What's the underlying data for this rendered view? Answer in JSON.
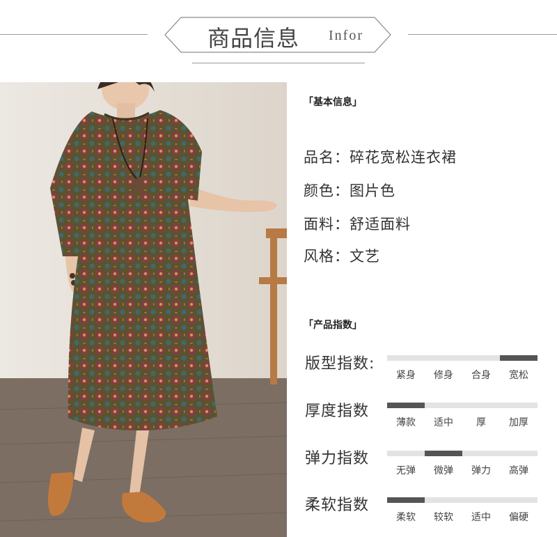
{
  "header": {
    "title_cn": "商品信息",
    "title_en": "Infor"
  },
  "basic_info": {
    "title": "「基本信息」",
    "rows": [
      {
        "label": "品名：",
        "value": "碎花宽松连衣裙"
      },
      {
        "label": "颜色：",
        "value": "图片色"
      },
      {
        "label": "面料：",
        "value": "舒适面料"
      },
      {
        "label": "风格：",
        "value": "文艺"
      }
    ]
  },
  "product_index": {
    "title": "「产品指数」",
    "metrics": [
      {
        "label": "版型指数:",
        "levels": [
          "紧身",
          "修身",
          "合身",
          "宽松"
        ],
        "selected": 4
      },
      {
        "label": "厚度指数",
        "levels": [
          "薄款",
          "适中",
          "厚",
          "加厚"
        ],
        "selected": 1
      },
      {
        "label": "弹力指数",
        "levels": [
          "无弹",
          "微弹",
          "弹力",
          "高弹"
        ],
        "selected": 2
      },
      {
        "label": "柔软指数",
        "levels": [
          "柔软",
          "较软",
          "适中",
          "偏硬"
        ],
        "selected": 1
      }
    ]
  },
  "colors": {
    "bar_fill": "#555555",
    "bar_track": "#e3e3e3",
    "line": "#9a9a9a"
  }
}
